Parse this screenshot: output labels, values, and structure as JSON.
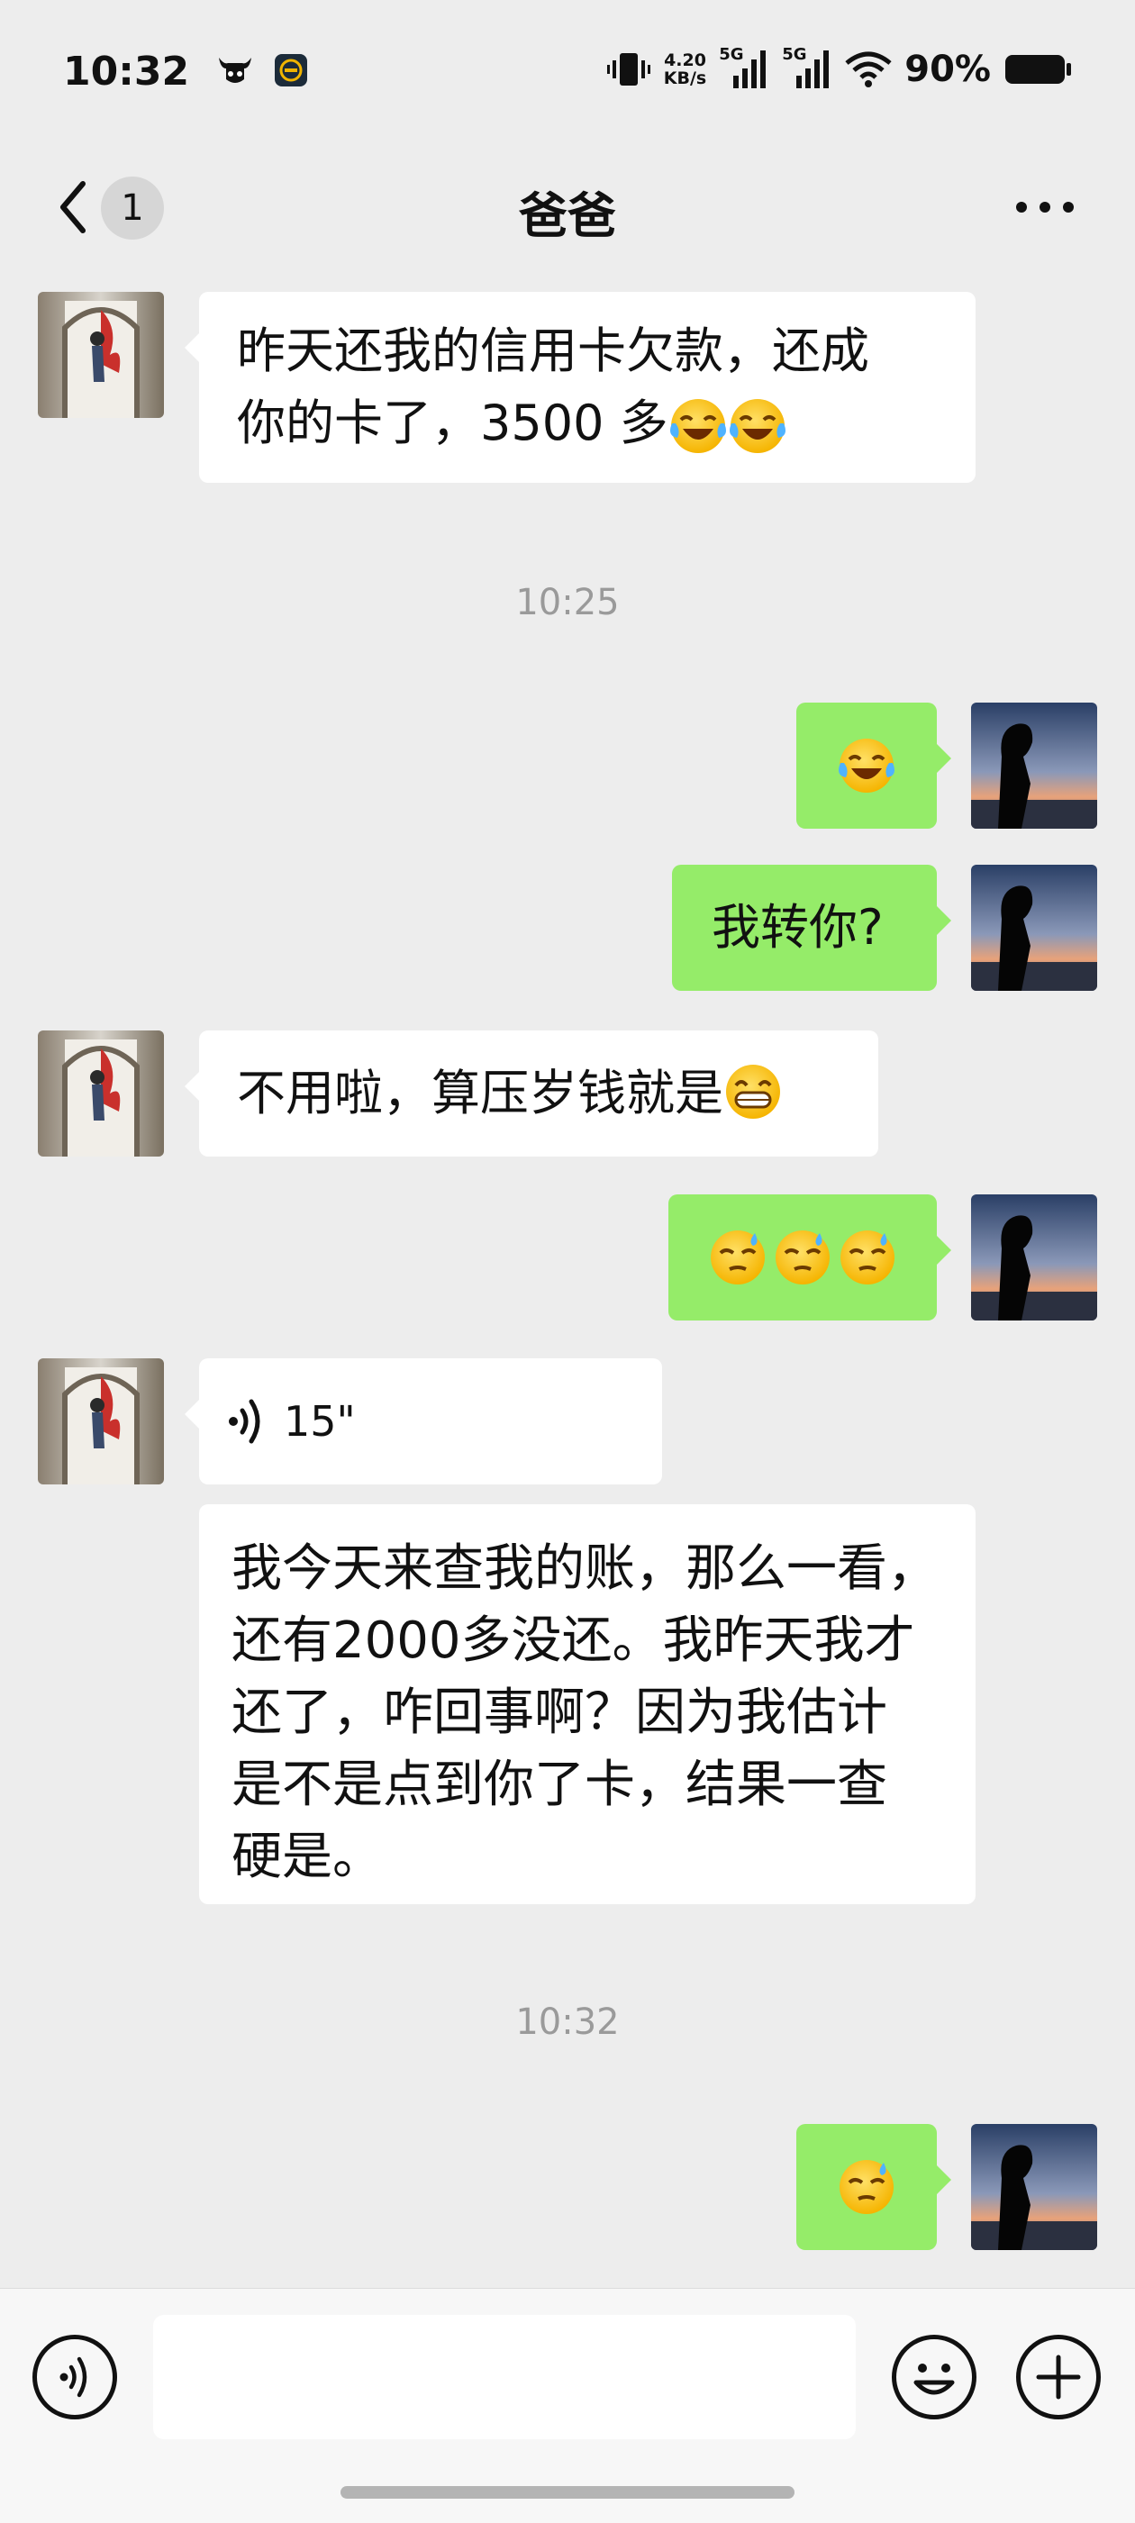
{
  "status_bar": {
    "time": "10:32",
    "net_speed": "4.20",
    "net_unit": "KB/s",
    "sim1": "5G",
    "sim2": "5G",
    "battery": "90%"
  },
  "nav": {
    "unread_count": "1",
    "title": "爸爸"
  },
  "messages": [
    {
      "side": "in",
      "text": "昨天还我的信用卡欠款，还成",
      "text2": "你的卡了，3500 多",
      "emoji": "laughing-crying"
    },
    {
      "timestamp": "10:25"
    },
    {
      "side": "out",
      "emoji": "laughing-crying"
    },
    {
      "side": "out",
      "text": "我转你?"
    },
    {
      "side": "in",
      "text": "不用啦，算压岁钱就是",
      "emoji": "grin"
    },
    {
      "side": "out",
      "emoji": "sweat"
    },
    {
      "side": "in",
      "voice_duration": "15\""
    },
    {
      "side": "in",
      "lines": [
        "我今天来查我的账，那么一看，",
        "还有2000多没还。我昨天我才",
        "还了，咋回事啊？因为我估计",
        "是不是点到你了卡，结果一查",
        "硬是。"
      ]
    },
    {
      "timestamp": "10:32"
    },
    {
      "side": "out",
      "emoji": "sweat"
    }
  ],
  "colors": {
    "background": "#ededed",
    "incoming_bubble": "#ffffff",
    "outgoing_bubble": "#95ec69",
    "timestamp": "#9a9a9a"
  }
}
